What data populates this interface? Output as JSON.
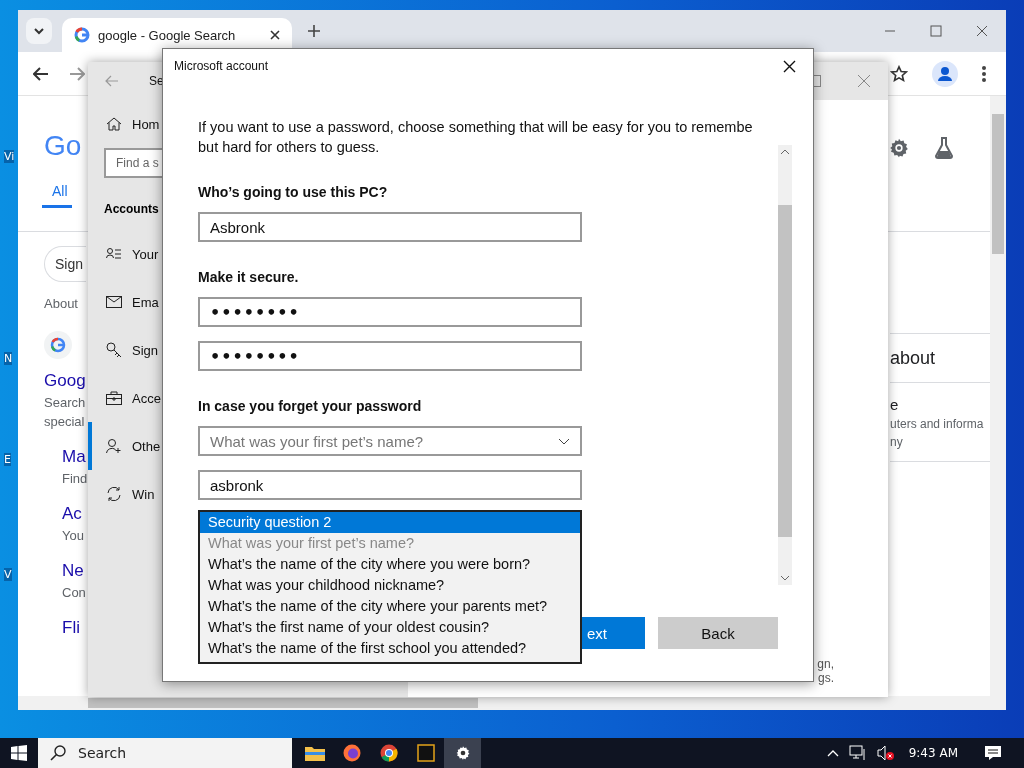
{
  "desktop": {
    "icon_labels": [
      "Vi",
      "N",
      "E",
      "V"
    ]
  },
  "browser": {
    "tab_title": "google - Google Search",
    "logo": "Go",
    "filter_tab": {
      "label": "All",
      "selected": true
    },
    "sign_in": "Sign",
    "about": "About",
    "result": {
      "site": "Goog",
      "snippet": [
        "Search",
        "special"
      ]
    },
    "sublinks": [
      {
        "title": "Ma",
        "text": "Find"
      },
      {
        "title": "Ac",
        "text": "You"
      },
      {
        "title": "Ne",
        "text": "Con"
      }
    ],
    "last_link": "Fli",
    "side_panel": {
      "heading": "about",
      "title": "e",
      "lines": [
        "uters and informa",
        "ny"
      ]
    }
  },
  "settings": {
    "title": "Se",
    "home": "Hom",
    "search_placeholder": "Find a s",
    "section": "Accounts",
    "nav": [
      {
        "label": "Your",
        "kind": "person",
        "selected": false
      },
      {
        "label": "Ema",
        "kind": "mail",
        "selected": false
      },
      {
        "label": "Sign",
        "kind": "key",
        "selected": false
      },
      {
        "label": "Acce",
        "kind": "case",
        "selected": false
      },
      {
        "label": "Othe",
        "kind": "adduser",
        "selected": true
      },
      {
        "label": "Win",
        "kind": "sync",
        "selected": false
      }
    ],
    "content_fragments": [
      "gn,",
      "gs."
    ]
  },
  "dialog": {
    "title": "Microsoft account",
    "intro_lines": [
      "If you want to use a password, choose something that will be easy for you to remembe",
      "but hard for others to guess."
    ],
    "name_label": "Who’s going to use this PC?",
    "name_value": "Asbronk",
    "password_label": "Make it secure.",
    "password_values": [
      "••••••••",
      "••••••••"
    ],
    "recovery_label": "In case you forget your password",
    "question_1": "What was your first pet’s name?",
    "answer_1": "asbronk",
    "question_2_options": [
      {
        "label": "Security question 2",
        "selected": true,
        "disabled": false
      },
      {
        "label": "What was your first pet’s name?",
        "selected": false,
        "disabled": true
      },
      {
        "label": "What’s the name of the city where you were born?",
        "selected": false,
        "disabled": false
      },
      {
        "label": "What was your childhood nickname?",
        "selected": false,
        "disabled": false
      },
      {
        "label": "What’s the name of the city where your parents met?",
        "selected": false,
        "disabled": false
      },
      {
        "label": "What’s the first name of your oldest cousin?",
        "selected": false,
        "disabled": false
      },
      {
        "label": "What’s the name of the first school you attended?",
        "selected": false,
        "disabled": false
      }
    ],
    "buttons": [
      {
        "label": "ext",
        "kind": "primary"
      },
      {
        "label": "Back",
        "kind": "secondary"
      }
    ]
  },
  "taskbar": {
    "search_placeholder": "Search",
    "apps": [
      {
        "kind": "folder",
        "selected": false
      },
      {
        "kind": "firefox",
        "selected": false
      },
      {
        "kind": "chrome",
        "selected": false
      },
      {
        "kind": "terminal",
        "selected": false
      },
      {
        "kind": "settings",
        "selected": true
      }
    ],
    "clock": "9:43 AM"
  }
}
